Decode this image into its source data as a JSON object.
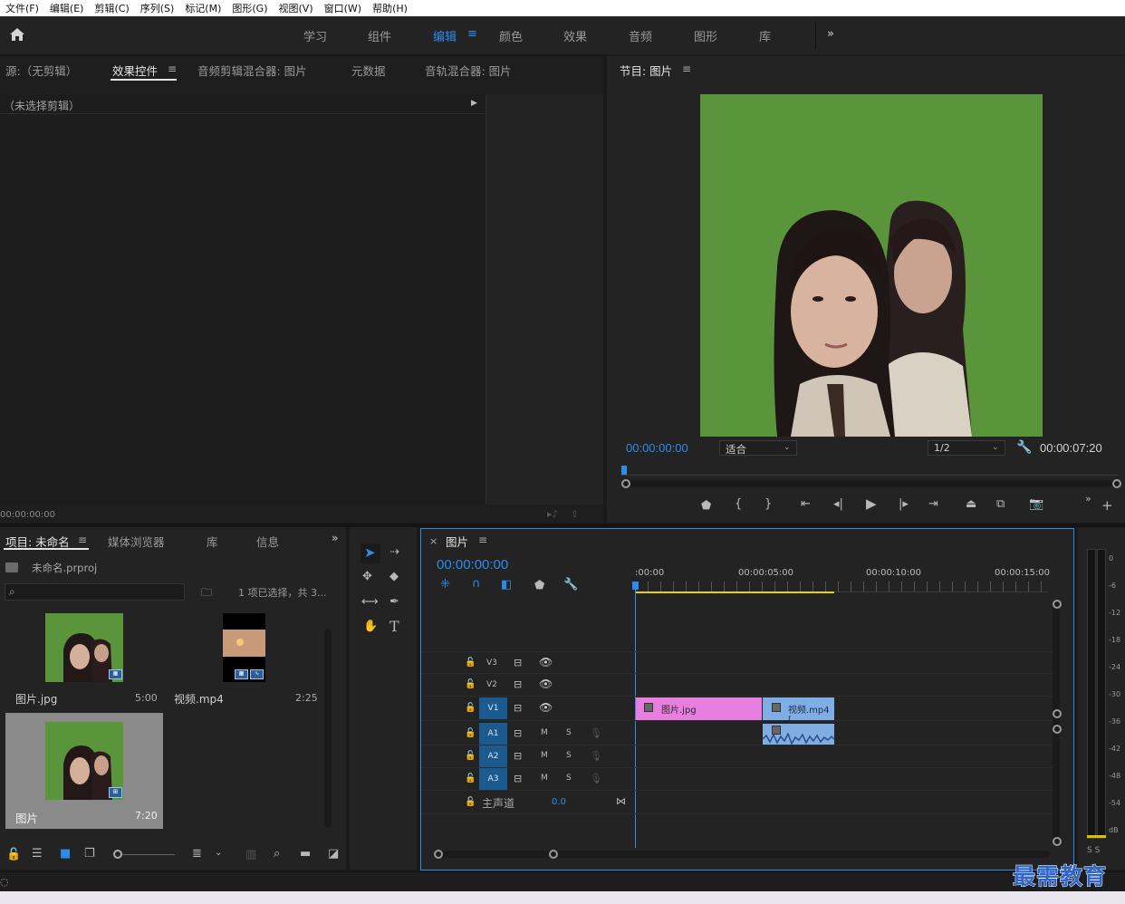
{
  "menu": [
    "文件(F)",
    "编辑(E)",
    "剪辑(C)",
    "序列(S)",
    "标记(M)",
    "图形(G)",
    "视图(V)",
    "窗口(W)",
    "帮助(H)"
  ],
  "workspaces": [
    "学习",
    "组件",
    "编辑",
    "颜色",
    "效果",
    "音频",
    "图形",
    "库"
  ],
  "workspace_active": "编辑",
  "source_panel": {
    "tabs": [
      "源:（无剪辑）",
      "效果控件",
      "音频剪辑混合器: 图片",
      "元数据",
      "音轨混合器: 图片"
    ],
    "active_tab": "效果控件",
    "no_clip_text": "（未选择剪辑）",
    "timecode": "00:00:00:00"
  },
  "program_monitor": {
    "title": "节目: 图片",
    "timecode": "00:00:00:00",
    "fit": "适合",
    "resolution": "1/2",
    "duration": "00:00:07:20",
    "bg_color": "#5a953c"
  },
  "project_panel": {
    "tabs": [
      "项目: 未命名",
      "媒体浏览器",
      "库",
      "信息"
    ],
    "project_file": "未命名.prproj",
    "selection_info": "1 项已选择，共 3...",
    "items": [
      {
        "name": "图片.jpg",
        "duration": "5:00"
      },
      {
        "name": "视频.mp4",
        "duration": "2:25"
      },
      {
        "name": "图片",
        "duration": "7:20"
      }
    ]
  },
  "timeline": {
    "title": "图片",
    "timecode": "00:00:00:00",
    "ruler": [
      ":00:00",
      "00:00:05:00",
      "00:00:10:00",
      "00:00:15:00"
    ],
    "video_tracks": [
      "V3",
      "V2",
      "V1"
    ],
    "audio_tracks": [
      "A1",
      "A2",
      "A3"
    ],
    "master_label": "主声道",
    "master_value": "0.0",
    "clips": {
      "image_clip": "图片.jpg",
      "video_clip": "视频.mp4 ["
    },
    "mute": "M",
    "solo": "S"
  },
  "meter": {
    "labels": [
      "0",
      "-6",
      "-12",
      "-18",
      "-24",
      "-30",
      "-36",
      "-42",
      "-48",
      "-54",
      "dB"
    ],
    "footer": "S S"
  },
  "watermark": "最需教育"
}
